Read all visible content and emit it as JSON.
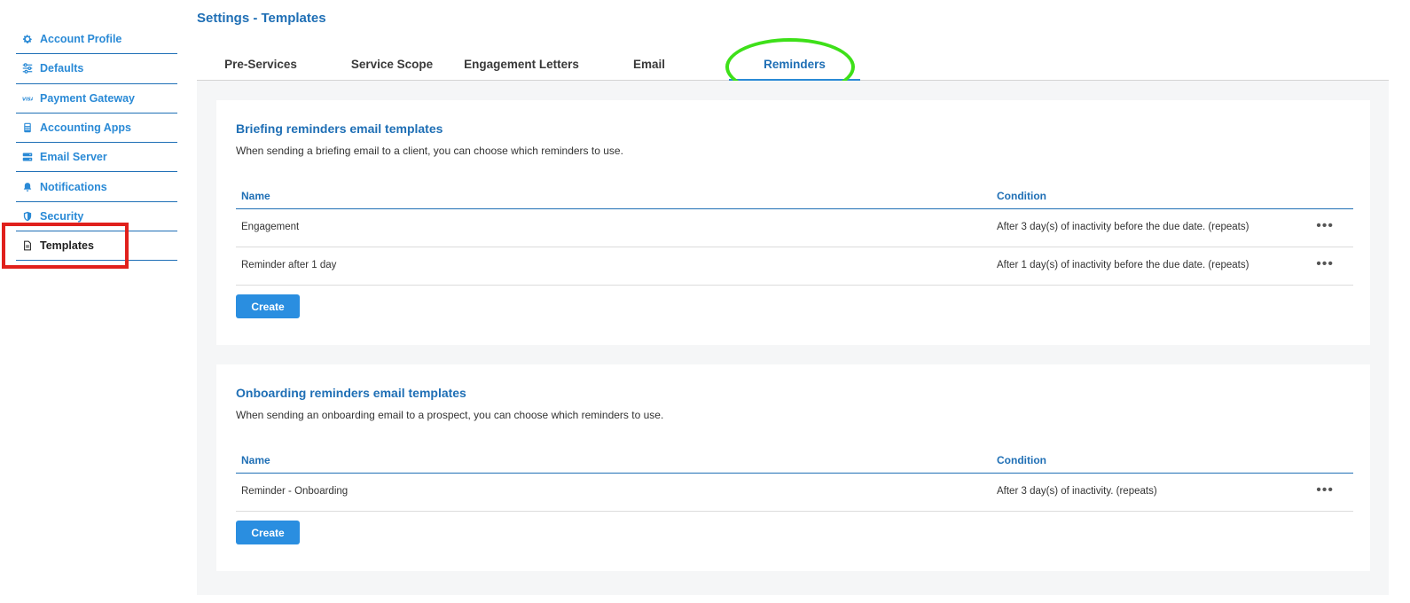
{
  "page": {
    "title": "Settings - Templates"
  },
  "sidebar": {
    "items": [
      {
        "label": "Account Profile",
        "icon": "gear-icon"
      },
      {
        "label": "Defaults",
        "icon": "sliders-icon"
      },
      {
        "label": "Payment Gateway",
        "icon": "visa-card-icon"
      },
      {
        "label": "Accounting Apps",
        "icon": "calculator-icon"
      },
      {
        "label": "Email Server",
        "icon": "server-icon"
      },
      {
        "label": "Notifications",
        "icon": "bell-icon"
      },
      {
        "label": "Security",
        "icon": "shield-icon"
      },
      {
        "label": "Templates",
        "icon": "document-icon",
        "active": true
      }
    ]
  },
  "tabs": [
    {
      "label": "Pre-Services"
    },
    {
      "label": "Service Scope"
    },
    {
      "label": "Engagement Letters"
    },
    {
      "label": "Email"
    },
    {
      "label": "Reminders",
      "active": true
    }
  ],
  "briefing": {
    "title": "Briefing reminders email templates",
    "description": "When sending a briefing email to a client, you can choose which reminders to use.",
    "col_name": "Name",
    "col_condition": "Condition",
    "rows": [
      {
        "name": "Engagement",
        "condition": "After 3 day(s) of inactivity before the due date. (repeats)"
      },
      {
        "name": "Reminder after 1 day",
        "condition": "After 1 day(s) of inactivity before the due date. (repeats)"
      }
    ],
    "create_label": "Create"
  },
  "onboarding": {
    "title": "Onboarding reminders email templates",
    "description": "When sending an onboarding email to a prospect, you can choose which reminders to use.",
    "col_name": "Name",
    "col_condition": "Condition",
    "rows": [
      {
        "name": "Reminder - Onboarding",
        "condition": "After 3 day(s) of inactivity. (repeats)"
      }
    ],
    "create_label": "Create"
  },
  "colors": {
    "accent": "#1f6fb5",
    "link": "#2a8ad6",
    "button": "#2a8ee0",
    "highlight_box": "#e0201c",
    "highlight_circle": "#3ee019"
  }
}
